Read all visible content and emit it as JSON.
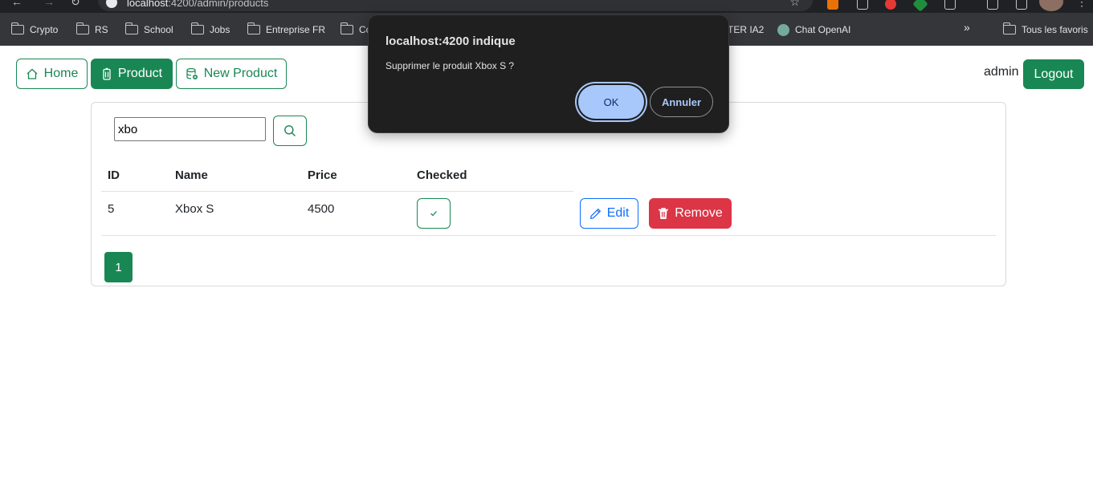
{
  "browser": {
    "url_host": "localhost",
    "url_rest": ":4200/admin/products",
    "bookmarks": [
      {
        "label": "Crypto",
        "icon": "folder-icon"
      },
      {
        "label": "RS",
        "icon": "folder-icon"
      },
      {
        "label": "School",
        "icon": "folder-icon"
      },
      {
        "label": "Jobs",
        "icon": "folder-icon"
      },
      {
        "label": "Entreprise FR",
        "icon": "folder-icon"
      },
      {
        "label": "Co",
        "icon": "folder-icon"
      },
      {
        "label": "TER IA2",
        "icon": ""
      },
      {
        "label": "Chat OpenAI",
        "icon": "chatgpt-icon"
      }
    ],
    "all_bookmarks": "Tous les favoris"
  },
  "nav": {
    "home": "Home",
    "product": "Product",
    "new_product": "New Product",
    "user": "admin",
    "logout": "Logout"
  },
  "search": {
    "value": "xbo"
  },
  "table": {
    "headers": [
      "ID",
      "Name",
      "Price",
      "Checked"
    ],
    "rows": [
      {
        "id": "5",
        "name": "Xbox S",
        "price": "4500",
        "checked": true
      }
    ],
    "edit_label": "Edit",
    "remove_label": "Remove"
  },
  "pagination": {
    "pages": [
      "1"
    ],
    "current": "1"
  },
  "dialog": {
    "title": "localhost:4200 indique",
    "message": "Supprimer le produit Xbox S ?",
    "ok": "OK",
    "cancel": "Annuler"
  },
  "colors": {
    "success": "#198754",
    "danger": "#dc3545",
    "primary": "#0d6efd",
    "dialog_bg": "#1f1f1f",
    "dialog_ok": "#a8c7fa"
  }
}
